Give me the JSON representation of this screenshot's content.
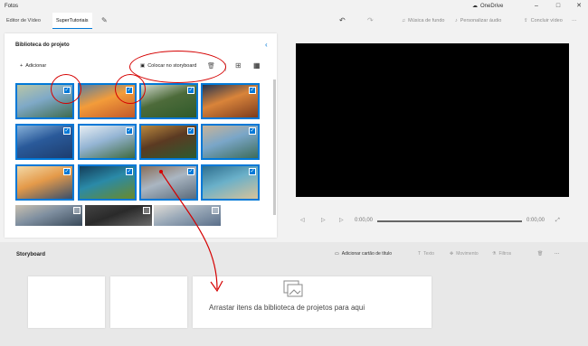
{
  "app": {
    "title": "Fotos",
    "onedrive": "OneDrive"
  },
  "toolbar": {
    "tab_editor": "Editor de Vídeo",
    "tab_project": "SuperTutoriais",
    "music": "Música de fundo",
    "custom_audio": "Personalizar áudio",
    "finish": "Concluir vídeo"
  },
  "library": {
    "title": "Biblioteca do projeto",
    "add": "Adicionar",
    "place_storyboard": "Colocar no storyboard",
    "thumbs": [
      {
        "colors": [
          "#7fa9c7",
          "#3e6b4f",
          "#b8c6a6"
        ],
        "checked": true
      },
      {
        "colors": [
          "#f39c3a",
          "#c2582a",
          "#5b7fa0"
        ],
        "checked": true
      },
      {
        "colors": [
          "#4d6b3a",
          "#2f5a2a",
          "#cfd7cc"
        ],
        "checked": true
      },
      {
        "colors": [
          "#d9843a",
          "#7c3b1e",
          "#263550"
        ],
        "checked": true
      },
      {
        "colors": [
          "#2a5a9a",
          "#1d3d6e",
          "#86b0d8"
        ],
        "checked": true
      },
      {
        "colors": [
          "#95b5d4",
          "#3f6a3e",
          "#e8eef3"
        ],
        "checked": true
      },
      {
        "colors": [
          "#5b3a22",
          "#2d5a2f",
          "#b8873e"
        ],
        "checked": true
      },
      {
        "colors": [
          "#7aa6c8",
          "#3d6c5a",
          "#c8b49a"
        ],
        "checked": true
      },
      {
        "colors": [
          "#e49a4a",
          "#394e6a",
          "#f3d9a7"
        ],
        "checked": true
      },
      {
        "colors": [
          "#2a8aa8",
          "#6a8a2a",
          "#143d59"
        ],
        "checked": true
      },
      {
        "colors": [
          "#aab6c2",
          "#5a6a7a",
          "#8a6f5a"
        ],
        "checked": true
      },
      {
        "colors": [
          "#6ab0c9",
          "#d7c29a",
          "#2f6f8f"
        ],
        "checked": true
      },
      {
        "colors": [
          "#7f8fa0",
          "#3a4a5a",
          "#c9c0b0"
        ],
        "checked": false
      },
      {
        "colors": [
          "#2a2a2a",
          "#6a6a6a",
          "#444"
        ],
        "checked": false
      },
      {
        "colors": [
          "#9aa9b8",
          "#5a6f8a",
          "#e0dcd6"
        ],
        "checked": false
      }
    ]
  },
  "player": {
    "time_start": "0:00,00",
    "time_end": "0:00,00",
    "progress": 0
  },
  "storyboard": {
    "title": "Storyboard",
    "add_title_card": "Adicionar cartão de título",
    "text": "Texto",
    "motion": "Movimento",
    "filters": "Filtros",
    "drop_hint": "Arrastar itens da biblioteca de projetos para aqui"
  }
}
